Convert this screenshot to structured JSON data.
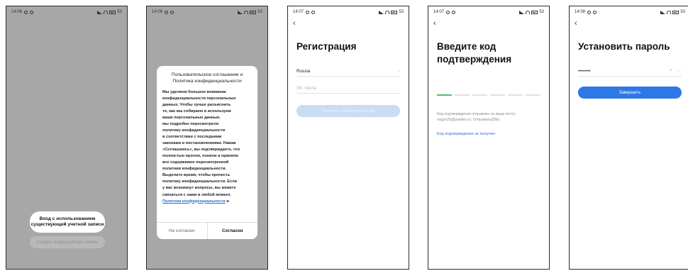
{
  "screens": {
    "s1": {
      "status_time": "14:06",
      "login_label_line1": "Вход с использованием",
      "login_label_line2": "существующей учетной записи",
      "create_account_label": "Создать новую учетную запись"
    },
    "s2": {
      "status_time": "14:06",
      "dialog_title_line1": "Пользовательское соглашение и",
      "dialog_title_line2": "Политика конфиденциальности",
      "body_lines": [
        "Мы уделяем большое внимание",
        "конфиденциальности персональных",
        "данных. Чтобы лучше разъяснить",
        "то, как мы собираем и используем",
        "ваши персональные данные,",
        "мы подробно пересмотрели",
        "политику конфиденциальности",
        "в соответствии с последними",
        "законами и постановлениями. Нажав",
        "«Соглашаюсь», вы подтверждаете, что",
        "полностью прочли, поняли и приняли",
        "все содержимое пересмотренной",
        "политики конфиденциальности.",
        "Выделите время, чтобы прочесть",
        "политику конфиденциальности. Если",
        "у вас возникнут вопросы, вы можете",
        "связаться с нами в любой момент."
      ],
      "policy_link": "Политика конфиденциальности",
      "policy_suffix": " и",
      "disagree_label": "Не согласен",
      "agree_label": "Согласен"
    },
    "s3": {
      "status_time": "14:07",
      "title": "Регистрация",
      "country_value": "Russia",
      "email_placeholder": "Эл. почта",
      "get_code_label": "Получить проверочный код"
    },
    "s4": {
      "status_time": "14:07",
      "title_line1": "Введите код",
      "title_line2": "подтверждения",
      "info_line1": "Код подтверждения отправлен на вашу почту:",
      "info_line2": "nagyo25@yandex.ru. Отправить(58s)",
      "not_received_link": "Код подтверждения не получен"
    },
    "s5": {
      "status_time": "14:08",
      "title": "Установить пароль",
      "password_value": "••••••••",
      "finish_label": "Завершить"
    }
  },
  "status": {
    "battery": "53"
  },
  "colors": {
    "primary": "#2d77e6",
    "primary_disabled": "#c8dcf5",
    "link": "#2f6fd4",
    "overlay": "#a7a7a7",
    "progress": "#5bb86e"
  }
}
